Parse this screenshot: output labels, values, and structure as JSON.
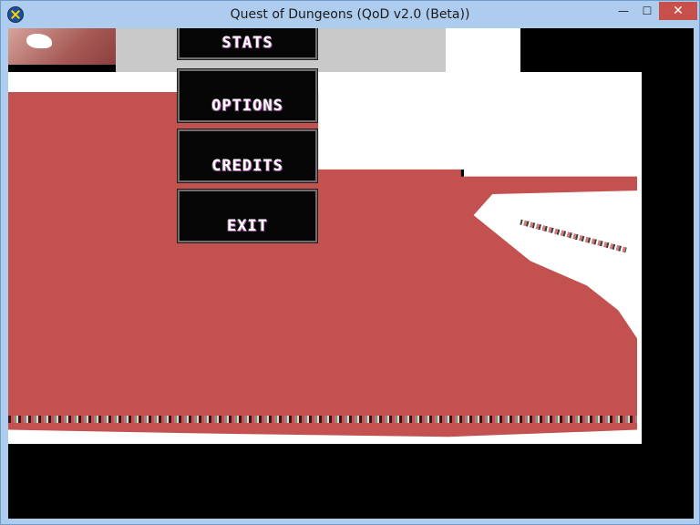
{
  "window": {
    "title": "Quest of Dungeons (QoD v2.0 (Beta))",
    "controls": {
      "minimize": "—",
      "maximize": "☐",
      "close": "✕"
    }
  },
  "menu": {
    "items": [
      {
        "label": "STATS"
      },
      {
        "label": "OPTIONS"
      },
      {
        "label": "CREDITS"
      },
      {
        "label": "EXIT"
      }
    ]
  },
  "colors": {
    "window_frame": "#aecdee",
    "close_button": "#c7504a",
    "button_fill": "#050505",
    "button_border": "#6e6e6e",
    "art_red": "#c25150",
    "background": "#000000"
  },
  "icons": {
    "app": "quest-of-dungeons-app-icon"
  }
}
